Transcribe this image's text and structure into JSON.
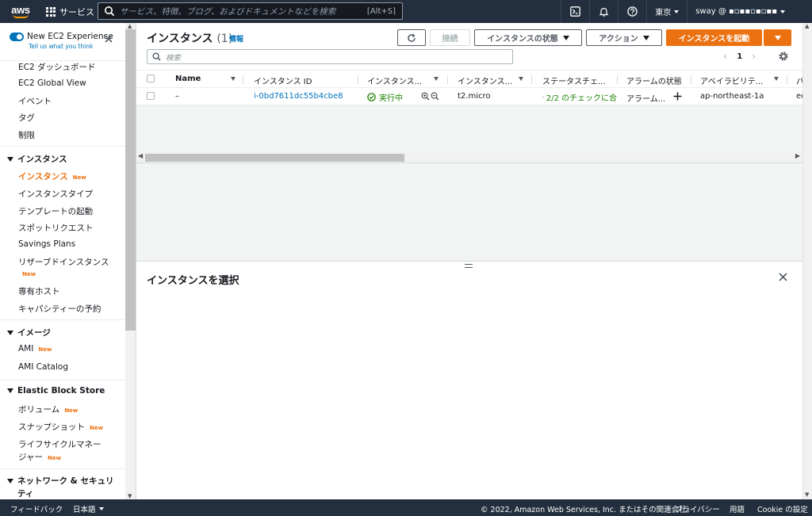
{
  "topbar": {
    "logo_text": "aws",
    "services_label": "サービス",
    "search_placeholder": "サービス、特徴、ブログ、およびドキュメントなどを検索",
    "search_shortcut": "[Alt+S]",
    "region": "東京",
    "account": "sway @ ▪▫▪▪▫▪▫▪▪"
  },
  "sidebar": {
    "toggle_label": "New EC2 Experience",
    "toggle_sub": "Tell us what you think",
    "badge_new": "New",
    "items_top": [
      "EC2 ダッシュボード",
      "EC2 Global View",
      "イベント",
      "タグ",
      "制限"
    ],
    "section_instances": "インスタンス",
    "instances_items": [
      "インスタンス",
      "インスタンスタイプ",
      "テンプレートの起動",
      "スポットリクエスト",
      "Savings Plans",
      "リザーブドインスタンス",
      "専有ホスト",
      "キャパシティーの予約"
    ],
    "section_images": "イメージ",
    "images_items": [
      "AMI",
      "AMI Catalog"
    ],
    "section_ebs": "Elastic Block Store",
    "ebs_items": [
      "ボリューム",
      "スナップショット",
      "ライフサイクルマネー",
      "ジャー"
    ],
    "section_network": "ネットワーク & セキュリ",
    "section_network_cont": "ティ"
  },
  "header": {
    "title": "インスタンス",
    "count": "(1)",
    "info": "情報",
    "btn_connect": "接続",
    "btn_state": "インスタンスの状態",
    "btn_actions": "アクション",
    "btn_launch": "インスタンスを起動",
    "search_placeholder": "検索",
    "page": "1"
  },
  "table": {
    "columns": [
      "Name",
      "インスタンス ID",
      "インスタンス...",
      "インスタンス...",
      "ステータスチェ...",
      "アラームの状態",
      "アベイラビリテ...",
      "パ"
    ],
    "row": {
      "name": "–",
      "instance_id": "i-0bd7611dc55b4cbe8",
      "state": "実行中",
      "type": "t2.micro",
      "status": "2/2 のチェックに合",
      "alarm": "アラーム...",
      "az": "ap-northeast-1a",
      "extra": "ec"
    }
  },
  "split": {
    "title": "インスタンスを選択"
  },
  "footer": {
    "feedback": "フィードバック",
    "language": "日本語",
    "copyright": "© 2022, Amazon Web Services, Inc. またはその関連会社。",
    "privacy": "プライバシー",
    "terms": "用語",
    "cookie": "Cookie の設定"
  },
  "colors": {
    "nav_bg": "#232f3e",
    "accent": "#ec7211",
    "link": "#0073bb",
    "success": "#1d8102"
  }
}
